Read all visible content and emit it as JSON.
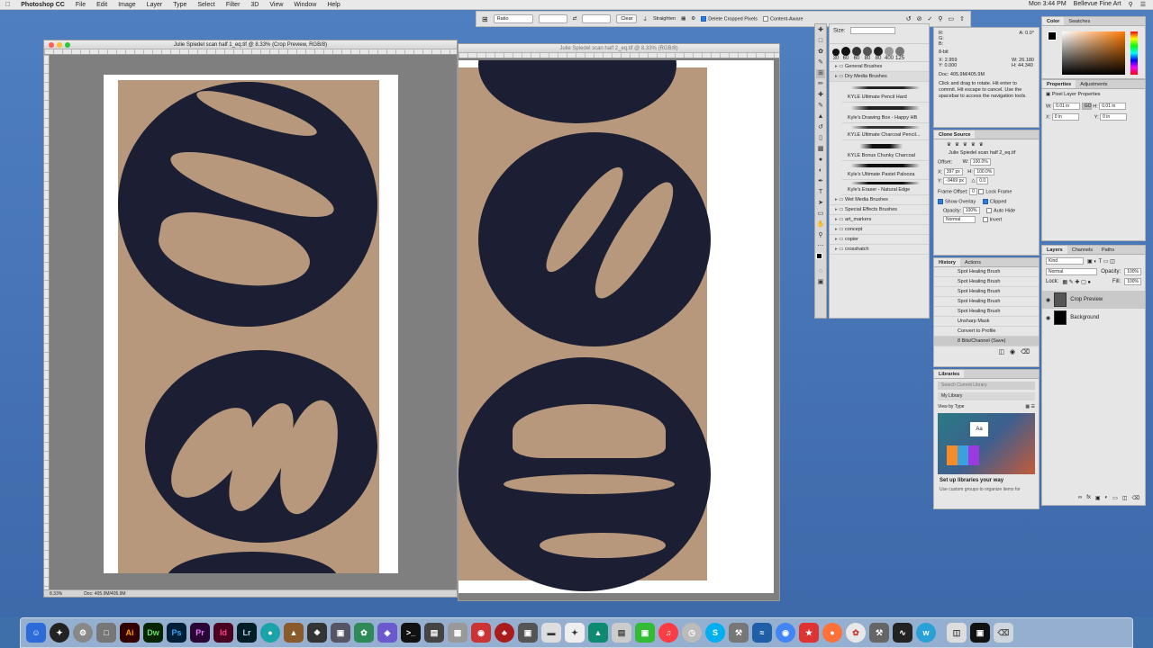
{
  "menubar": {
    "app_name": "Photoshop CC",
    "items": [
      "File",
      "Edit",
      "Image",
      "Layer",
      "Type",
      "Select",
      "Filter",
      "3D",
      "View",
      "Window",
      "Help"
    ],
    "clock": "Mon 3:44 PM",
    "user": "Bellevue Fine Art"
  },
  "options_bar": {
    "ratio": "Ratio",
    "clear": "Clear",
    "straighten": "Straighten",
    "delete_cropped": "Delete Cropped Pixels",
    "content_aware": "Content-Aware"
  },
  "doc1": {
    "title": "Julie Spiedel scan half 1_eq.tif @ 8.33% (Crop Preview, RGB/8)",
    "zoom": "8.33%",
    "doc_size": "Doc: 405.9M/405.9M"
  },
  "doc2": {
    "title": "Julie Spiedel scan half 2_eq.tif @ 8.33% (RGB/8)",
    "zoom": "8.33%"
  },
  "brushes": {
    "size_label": "Size:",
    "sizes": [
      "30",
      "60",
      "60",
      "80",
      "80",
      "400",
      "125"
    ],
    "folders": [
      "General Brushes",
      "Dry Media Brushes"
    ],
    "items": [
      "KYLE Ultimate Pencil Hard",
      "Kyle's Drawing Box - Happy HB",
      "KYLE Ultimate Charcoal Pencil...",
      "KYLE Bonus Chunky Charcoal",
      "Kyle's Ultimate Pastel Palooza",
      "Kyle's Eraser - Natural Edge"
    ],
    "more_folders": [
      "Wet Media Brushes",
      "Special Effects Brushes",
      "art_markers",
      "concept",
      "copier",
      "crosshatch"
    ]
  },
  "info": {
    "r": "R:",
    "g": "G:",
    "b": "B:",
    "a_label": "A:",
    "a_value": "0.0°",
    "bit": "8-bit",
    "x_label": "X:",
    "x_value": "2.959",
    "y_label": "Y:",
    "y_value": "0.000",
    "w_label": "W:",
    "w_value": "26.180",
    "h_label": "H:",
    "h_value": "44.340",
    "doc_line": "Doc: 405.9M/405.9M",
    "help": "Click and drag to rotate. Hit enter to commit. Hit escape to cancel. Use the spacebar to access the navigation tools."
  },
  "clone_source": {
    "title": "Clone Source",
    "file": "Julie Spiedel scan half 2_eq.tif",
    "offset": "Offset:",
    "x": "397 px",
    "y": "-9469 px",
    "w": "100.0%",
    "h": "100.0%",
    "angle": "0.0",
    "frame_offset": "Frame Offset:",
    "frame_value": "0",
    "lock_frame": "Lock Frame",
    "show_overlay": "Show Overlay",
    "clipped": "Clipped",
    "opacity_label": "Opacity:",
    "opacity": "100%",
    "auto_hide": "Auto Hide",
    "blend": "Normal",
    "invert": "Invert"
  },
  "history": {
    "tabs": [
      "History",
      "Actions"
    ],
    "items": [
      "Spot Healing Brush",
      "Spot Healing Brush",
      "Spot Healing Brush",
      "Spot Healing Brush",
      "Spot Healing Brush",
      "Unsharp Mask",
      "Convert to Profile",
      "8 Bits/Channel (Save)"
    ]
  },
  "libraries": {
    "title": "Libraries",
    "search": "Search Current Library",
    "library": "My Library",
    "view_by": "View by Type",
    "promo_title": "Set up libraries your way",
    "promo_text": "Use custom groups to organize items for"
  },
  "color": {
    "tabs": [
      "Color",
      "Swatches"
    ],
    "accent": "#ff7a00"
  },
  "properties": {
    "tabs": [
      "Properties",
      "Adjustments"
    ],
    "title": "Pixel Layer Properties",
    "w_label": "W:",
    "w": "0.01 in",
    "h_label": "H:",
    "h": "0.01 in",
    "x_label": "X:",
    "x": "0 in",
    "y_label": "Y:",
    "y": "0 in",
    "go": "GO"
  },
  "layers": {
    "tabs": [
      "Layers",
      "Channels",
      "Paths"
    ],
    "kind": "Kind",
    "blend": "Normal",
    "opacity_label": "Opacity:",
    "opacity": "100%",
    "lock": "Lock:",
    "fill_label": "Fill:",
    "fill": "100%",
    "items": [
      "Crop Preview",
      "Background"
    ]
  },
  "dock": {
    "apps": [
      "Ai",
      "Dw",
      "Ps",
      "Pr",
      "Id",
      "Lr"
    ]
  }
}
